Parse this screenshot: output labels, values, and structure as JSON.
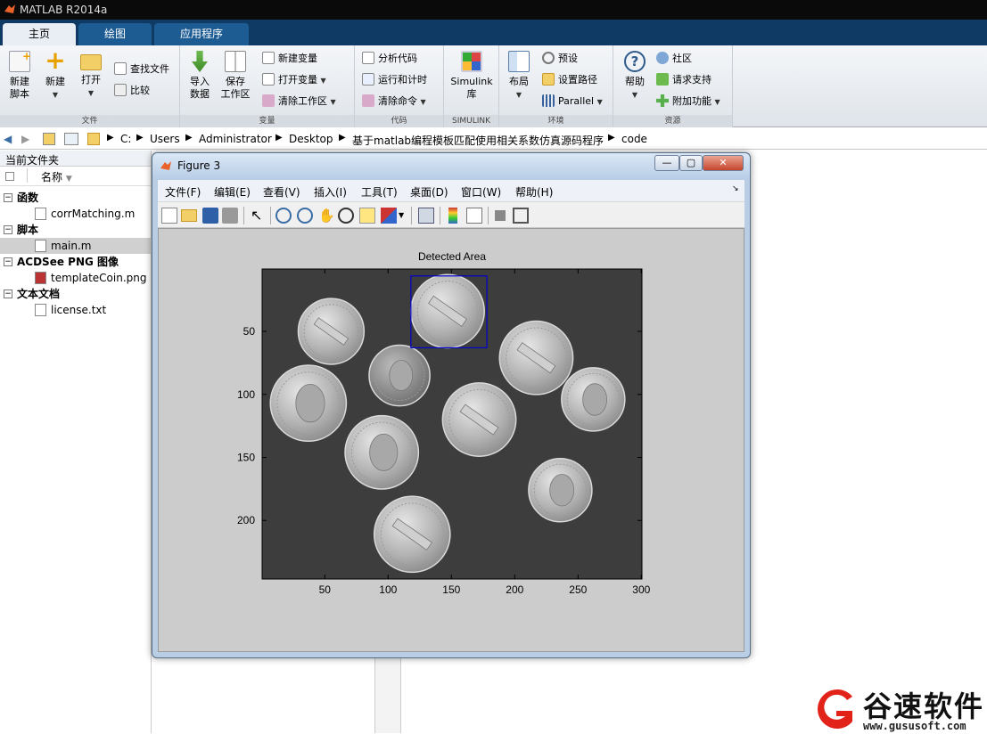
{
  "window": {
    "title": "MATLAB R2014a"
  },
  "tabs": [
    "主页",
    "绘图",
    "应用程序"
  ],
  "ribbon": {
    "file": {
      "label": "文件",
      "new_script": "新建\n脚本",
      "new": "新建",
      "open": "打开",
      "find_files": "查找文件",
      "compare": "比较"
    },
    "variable": {
      "label": "变量",
      "import": "导入\n数据",
      "save_ws": "保存\n工作区",
      "new_var": "新建变量",
      "open_var": "打开变量",
      "clear_ws": "清除工作区"
    },
    "code": {
      "label": "代码",
      "analyze": "分析代码",
      "run_time": "运行和计时",
      "clear_cmd": "清除命令"
    },
    "simulink": {
      "label": "SIMULINK",
      "lib": "Simulink\n库"
    },
    "env": {
      "label": "环境",
      "layout": "布局",
      "prefs": "预设",
      "set_path": "设置路径",
      "parallel": "Parallel"
    },
    "resources": {
      "label": "资源",
      "help": "帮助",
      "community": "社区",
      "support": "请求支持",
      "addons": "附加功能"
    }
  },
  "address": [
    "C:",
    "Users",
    "Administrator",
    "Desktop",
    "基于matlab编程模板匹配使用相关系数仿真源码程序",
    "code"
  ],
  "file_panel": {
    "title": "当前文件夹",
    "col_name": "名称",
    "sections": [
      {
        "name": "函数",
        "items": [
          "corrMatching.m"
        ]
      },
      {
        "name": "脚本",
        "items": [
          "main.m"
        ]
      },
      {
        "name": "ACDSee PNG 图像",
        "items": [
          "templateCoin.png"
        ]
      },
      {
        "name": "文本文档",
        "items": [
          "license.txt"
        ]
      }
    ],
    "selected": "main.m"
  },
  "figure": {
    "title": "Figure 3",
    "menu": [
      "文件(F)",
      "编辑(E)",
      "查看(V)",
      "插入(I)",
      "工具(T)",
      "桌面(D)",
      "窗口(W)",
      "帮助(H)"
    ],
    "window_buttons": [
      "—",
      "▢",
      "✕"
    ]
  },
  "chart_data": {
    "type": "image",
    "title": "Detected Area",
    "xlabel": "",
    "ylabel": "",
    "xticks": [
      50,
      100,
      150,
      200,
      250,
      300
    ],
    "yticks": [
      50,
      100,
      150,
      200
    ],
    "xlim": [
      0.5,
      300.5
    ],
    "ylim": [
      0.5,
      246.5
    ],
    "y_reversed": true,
    "detected_rect": {
      "x": 118,
      "y": 6,
      "w": 60,
      "h": 57,
      "color": "#0000cc"
    },
    "coins": [
      {
        "cx": 55,
        "cy": 50,
        "r": 26,
        "kind": "nickel"
      },
      {
        "cx": 147,
        "cy": 34,
        "r": 29,
        "kind": "nickel"
      },
      {
        "cx": 217,
        "cy": 71,
        "r": 29,
        "kind": "nickel"
      },
      {
        "cx": 109,
        "cy": 85,
        "r": 24,
        "kind": "dime"
      },
      {
        "cx": 37,
        "cy": 107,
        "r": 30,
        "kind": "quarter"
      },
      {
        "cx": 262,
        "cy": 104,
        "r": 25,
        "kind": "dime"
      },
      {
        "cx": 172,
        "cy": 120,
        "r": 29,
        "kind": "nickel"
      },
      {
        "cx": 95,
        "cy": 146,
        "r": 29,
        "kind": "quarter"
      },
      {
        "cx": 236,
        "cy": 176,
        "r": 25,
        "kind": "dime"
      },
      {
        "cx": 119,
        "cy": 211,
        "r": 30,
        "kind": "nickel"
      }
    ]
  },
  "watermark": {
    "brand": "谷速软件",
    "url": "www.gususoft.com"
  }
}
